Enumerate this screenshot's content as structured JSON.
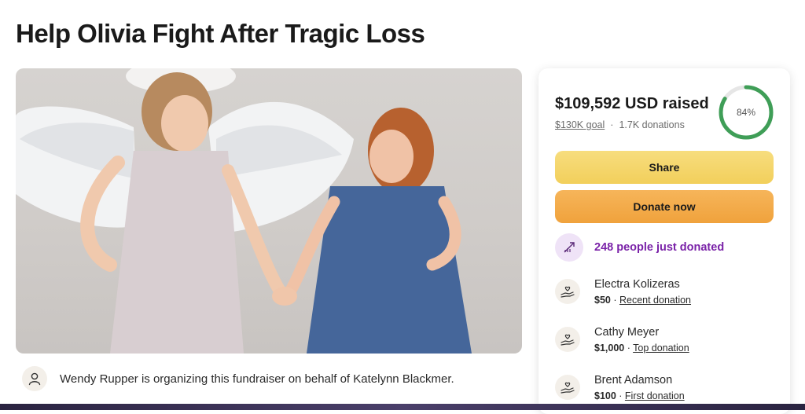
{
  "page": {
    "title": "Help Olivia Fight After Tragic Loss"
  },
  "organizer": {
    "text": "Wendy Rupper is organizing this fundraiser on behalf of Katelynn Blackmer."
  },
  "donation_card": {
    "raised": "$109,592 USD raised",
    "goal": "$130K goal",
    "separator": "·",
    "donations_count": "1.7K donations",
    "progress_label": "84%",
    "progress_fraction": 0.84,
    "share_label": "Share",
    "donate_label": "Donate now",
    "trend_text": "248 people just donated",
    "donors": [
      {
        "name": "Electra Kolizeras",
        "amount": "$50",
        "sep": " · ",
        "label": "Recent donation"
      },
      {
        "name": "Cathy Meyer",
        "amount": "$1,000",
        "sep": " · ",
        "label": "Top donation"
      },
      {
        "name": "Brent Adamson",
        "amount": "$100",
        "sep": " · ",
        "label": "First donation"
      }
    ]
  },
  "colors": {
    "progress": "#3f9e57",
    "share_bg": "#f4d46a",
    "donate_bg": "#f2a944",
    "trend_text": "#7a22a8"
  }
}
